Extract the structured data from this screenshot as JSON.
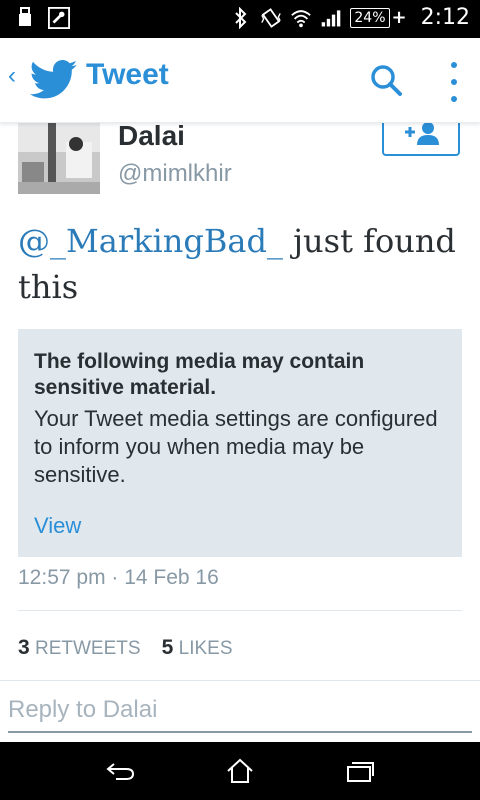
{
  "status_bar": {
    "battery_percent": "24%",
    "battery_charging": "+",
    "time": "2:12",
    "icons": [
      "usb-icon",
      "debug-icon",
      "bluetooth-icon",
      "vibrate-icon",
      "wifi-icon",
      "signal-icon"
    ]
  },
  "action_bar": {
    "title": "Tweet",
    "icons": [
      "back-chevron-icon",
      "twitter-bird-icon",
      "search-icon",
      "overflow-menu-icon"
    ],
    "accent_color": "#2b8fd8"
  },
  "tweet": {
    "author_name": "Dalai",
    "author_handle": "@mimlkhir",
    "mention": "@_MarkingBad_",
    "text_rest": " just found this",
    "sensitive_title": "The following media may contain sensitive material.",
    "sensitive_body": "Your Tweet media settings are configured to inform you when media may be sensitive.",
    "view_label": "View",
    "timestamp": "12:57 pm · 14 Feb 16",
    "retweets_count": "3",
    "retweets_label": "RETWEETS",
    "likes_count": "5",
    "likes_label": "LIKES"
  },
  "reply": {
    "placeholder": "Reply to Dalai"
  }
}
